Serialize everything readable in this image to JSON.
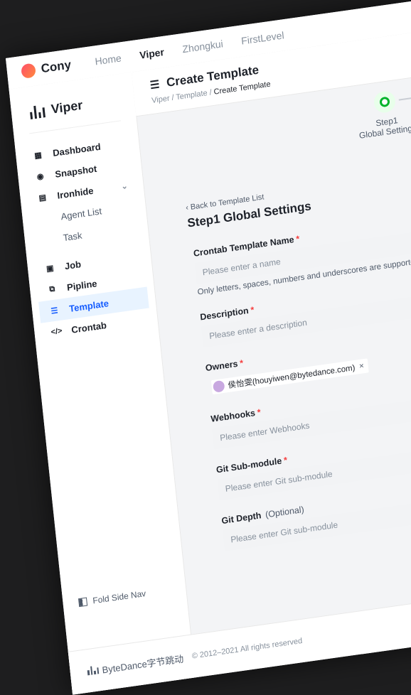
{
  "app": {
    "brand": "Cony"
  },
  "topnav": [
    "Home",
    "Viper",
    "Zhongkui",
    "FirstLevel"
  ],
  "sidebar": {
    "brand": "Viper",
    "items": [
      {
        "label": "Dashboard",
        "icon": "grid-icon"
      },
      {
        "label": "Snapshot",
        "icon": "eye-icon"
      },
      {
        "label": "Ironhide",
        "icon": "server-icon"
      },
      {
        "label": "Agent List"
      },
      {
        "label": "Task"
      },
      {
        "label": "Job",
        "icon": "job-icon"
      },
      {
        "label": "Pipline",
        "icon": "pipeline-icon"
      },
      {
        "label": "Template",
        "icon": "template-icon"
      },
      {
        "label": "Crontab",
        "icon": "code-icon"
      }
    ],
    "fold_label": "Fold Side Nav"
  },
  "header": {
    "title": "Create Template",
    "breadcrumb": [
      "Viper",
      "Template",
      "Create Template"
    ]
  },
  "steps": {
    "step1_number": "Step1",
    "step1_title": "Global Settings"
  },
  "form": {
    "back_label": "Back to Template List",
    "title": "Step1 Global Settings",
    "name_label": "Crontab Template Name",
    "name_placeholder": "Please enter a name",
    "name_hint": "Only letters, spaces, numbers and underscores are supported.",
    "description_label": "Description",
    "description_placeholder": "Please enter a description",
    "owners_label": "Owners",
    "owner_tag": "侯怡雯(houyiwen@bytedance.com)",
    "webhooks_label": "Webhooks",
    "webhooks_placeholder": "Please enter Webhooks",
    "git_submodule_label": "Git Sub-module",
    "git_submodule_placeholder": "Please enter Git sub-module",
    "git_depth_label": "Git Depth",
    "git_depth_optional": "(Optional)",
    "git_depth_placeholder": "Please enter Git sub-module"
  },
  "footer": {
    "company": "ByteDance字节跳动",
    "copyright": "© 2012–2021 All rights reserved"
  },
  "colors": {
    "accent": "#165dff",
    "active_bg": "#e8f3ff",
    "required": "#f53f3f",
    "step": "#00b42a"
  }
}
